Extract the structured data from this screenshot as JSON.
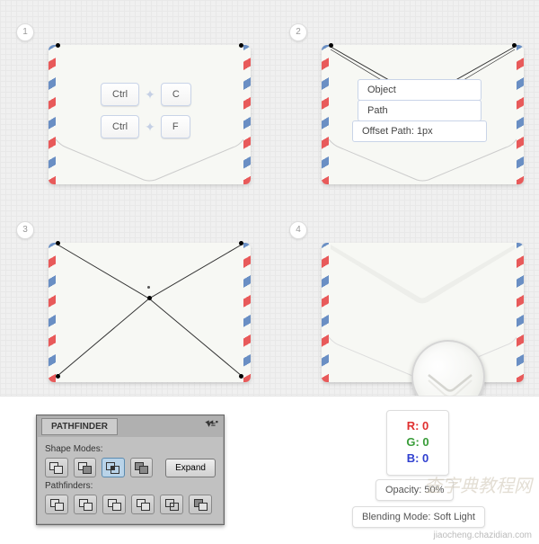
{
  "steps": {
    "s1": "1",
    "s2": "2",
    "s3": "3",
    "s4": "4"
  },
  "keys": {
    "ctrl": "Ctrl",
    "c": "C",
    "f": "F"
  },
  "tooltip": {
    "object": "Object",
    "path": "Path",
    "offset": "Offset Path: 1px"
  },
  "pathfinder": {
    "title": "PATHFINDER",
    "shape_modes": "Shape Modes:",
    "pathfinders": "Pathfinders:",
    "expand": "Expand"
  },
  "rgb": {
    "r": "R: 0",
    "g": "G: 0",
    "b": "B: 0"
  },
  "props": {
    "opacity": "Opacity: 50%",
    "blend": "Blending Mode: Soft Light"
  },
  "watermark": "jiaocheng.chazidian.com"
}
